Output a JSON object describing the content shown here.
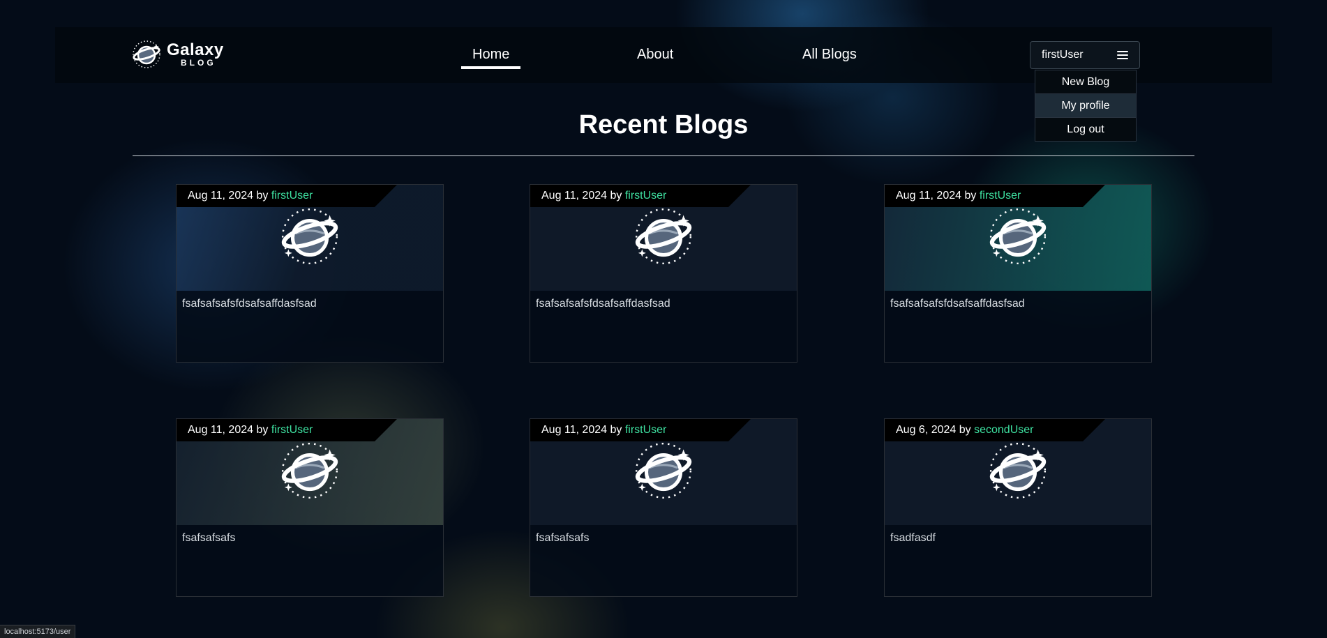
{
  "brand": {
    "name": "Galaxy",
    "sub": "BLOG"
  },
  "nav": {
    "home": "Home",
    "about": "About",
    "all_blogs": "All Blogs"
  },
  "user_menu": {
    "username": "firstUser",
    "items": [
      "New Blog",
      "My profile",
      "Log out"
    ]
  },
  "page": {
    "title": "Recent Blogs"
  },
  "cards": [
    {
      "date": "Aug 11, 2024",
      "by": "by",
      "author": "firstUser",
      "title": "fsafsafsafsfdsafsaffdasfsad"
    },
    {
      "date": "Aug 11, 2024",
      "by": "by",
      "author": "firstUser",
      "title": "fsafsafsafsfdsafsaffdasfsad"
    },
    {
      "date": "Aug 11, 2024",
      "by": "by",
      "author": "firstUser",
      "title": "fsafsafsafsfdsafsaffdasfsad"
    },
    {
      "date": "Aug 11, 2024",
      "by": "by",
      "author": "firstUser",
      "title": "fsafsafsafs"
    },
    {
      "date": "Aug 11, 2024",
      "by": "by",
      "author": "firstUser",
      "title": "fsafsafsafs"
    },
    {
      "date": "Aug 6, 2024",
      "by": "by",
      "author": "secondUser",
      "title": "fsadfasdf"
    }
  ],
  "status_bar": {
    "url": "localhost:5173/user"
  },
  "colors": {
    "author": "#3ee0a0",
    "background": "#040c18"
  }
}
